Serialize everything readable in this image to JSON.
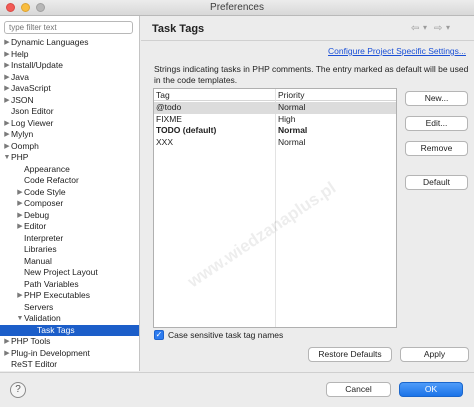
{
  "window": {
    "title": "Preferences"
  },
  "filter": {
    "placeholder": "type filter text"
  },
  "tree": [
    {
      "label": "Dynamic Languages",
      "arrow": "▶",
      "level": 0
    },
    {
      "label": "Help",
      "arrow": "▶",
      "level": 0
    },
    {
      "label": "Install/Update",
      "arrow": "▶",
      "level": 0
    },
    {
      "label": "Java",
      "arrow": "▶",
      "level": 0
    },
    {
      "label": "JavaScript",
      "arrow": "▶",
      "level": 0
    },
    {
      "label": "JSON",
      "arrow": "▶",
      "level": 0
    },
    {
      "label": "Json Editor",
      "arrow": "",
      "level": 0
    },
    {
      "label": "Log Viewer",
      "arrow": "▶",
      "level": 0
    },
    {
      "label": "Mylyn",
      "arrow": "▶",
      "level": 0
    },
    {
      "label": "Oomph",
      "arrow": "▶",
      "level": 0
    },
    {
      "label": "PHP",
      "arrow": "▼",
      "level": 0
    },
    {
      "label": "Appearance",
      "arrow": "",
      "level": 1
    },
    {
      "label": "Code Refactor",
      "arrow": "",
      "level": 1
    },
    {
      "label": "Code Style",
      "arrow": "▶",
      "level": 1
    },
    {
      "label": "Composer",
      "arrow": "▶",
      "level": 1
    },
    {
      "label": "Debug",
      "arrow": "▶",
      "level": 1
    },
    {
      "label": "Editor",
      "arrow": "▶",
      "level": 1
    },
    {
      "label": "Interpreter",
      "arrow": "",
      "level": 1
    },
    {
      "label": "Libraries",
      "arrow": "",
      "level": 1
    },
    {
      "label": "Manual",
      "arrow": "",
      "level": 1
    },
    {
      "label": "New Project Layout",
      "arrow": "",
      "level": 1
    },
    {
      "label": "Path Variables",
      "arrow": "",
      "level": 1
    },
    {
      "label": "PHP Executables",
      "arrow": "▶",
      "level": 1
    },
    {
      "label": "Servers",
      "arrow": "",
      "level": 1
    },
    {
      "label": "Validation",
      "arrow": "▼",
      "level": 1
    },
    {
      "label": "Task Tags",
      "arrow": "",
      "level": 2,
      "selected": true
    },
    {
      "label": "PHP Tools",
      "arrow": "▶",
      "level": 0
    },
    {
      "label": "Plug-in Development",
      "arrow": "▶",
      "level": 0
    },
    {
      "label": "ReST Editor",
      "arrow": "",
      "level": 0
    }
  ],
  "page": {
    "title": "Task Tags",
    "nav_back": "⇦",
    "nav_back_menu": "▾",
    "nav_forward": "⇨",
    "nav_forward_menu": "▾",
    "configure_link": "Configure Project Specific Settings...",
    "description": "Strings indicating tasks in PHP comments. The entry marked as default will be used in the code templates."
  },
  "table": {
    "headers": [
      "Tag",
      "Priority"
    ],
    "rows": [
      {
        "tag": "@todo",
        "priority": "Normal",
        "selected": true,
        "bold": false
      },
      {
        "tag": "FIXME",
        "priority": "High",
        "selected": false,
        "bold": false
      },
      {
        "tag": "TODO (default)",
        "priority": "Normal",
        "selected": false,
        "bold": true
      },
      {
        "tag": "XXX",
        "priority": "Normal",
        "selected": false,
        "bold": false
      }
    ]
  },
  "buttons": {
    "new": "New...",
    "edit": "Edit...",
    "remove": "Remove",
    "default": "Default",
    "restore_defaults": "Restore Defaults",
    "apply": "Apply",
    "cancel": "Cancel",
    "ok": "OK"
  },
  "checkbox": {
    "label": "Case sensitive task tag names",
    "checked": true,
    "mark": "✓"
  },
  "help": {
    "glyph": "?"
  },
  "watermark": "www.wiedzanaplus.pl"
}
